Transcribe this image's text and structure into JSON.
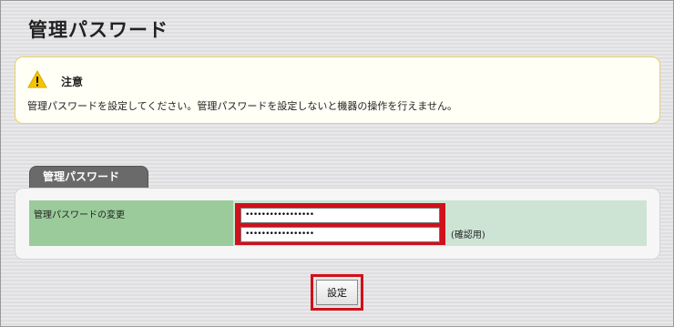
{
  "page": {
    "title": "管理パスワード"
  },
  "notice": {
    "heading": "注意",
    "message": "管理パスワードを設定してください。管理パスワードを設定しないと機器の操作を行えません。",
    "icon": "warning-icon",
    "accent_color": "#f5c400"
  },
  "section": {
    "tab_label": "管理パスワード",
    "row_label": "管理パスワードの変更",
    "password_value": "•••••••••••••••••",
    "password_confirm_value": "•••••••••••••••••",
    "confirm_note": "(確認用)"
  },
  "actions": {
    "submit_label": "設定"
  },
  "colors": {
    "highlight": "#d0101a",
    "label_cell": "#9bcb9b",
    "value_cell": "#cde4d5",
    "tab": "#6a6a6a"
  }
}
